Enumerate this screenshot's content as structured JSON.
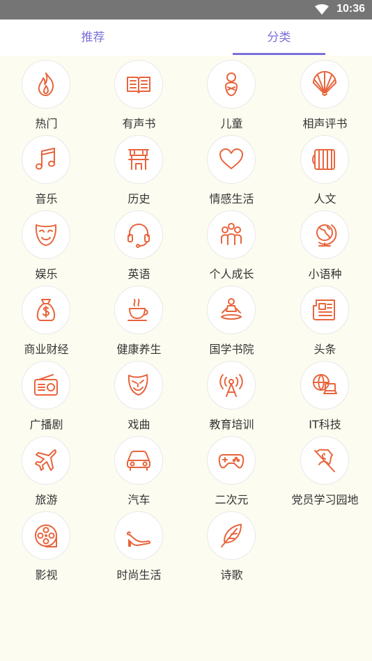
{
  "status": {
    "time": "10:36"
  },
  "tabs": [
    {
      "label": "推荐",
      "active": false
    },
    {
      "label": "分类",
      "active": true
    }
  ],
  "accent_color": "#7b70d6",
  "icon_color": "#e8643c",
  "categories": [
    {
      "label": "热门",
      "icon": "fire-icon"
    },
    {
      "label": "有声书",
      "icon": "open-book-icon"
    },
    {
      "label": "儿童",
      "icon": "baby-icon"
    },
    {
      "label": "相声评书",
      "icon": "folding-fan-icon"
    },
    {
      "label": "音乐",
      "icon": "music-note-icon"
    },
    {
      "label": "历史",
      "icon": "ancient-gate-icon"
    },
    {
      "label": "情感生活",
      "icon": "heart-icon"
    },
    {
      "label": "人文",
      "icon": "scroll-icon"
    },
    {
      "label": "娱乐",
      "icon": "mask-icon"
    },
    {
      "label": "英语",
      "icon": "headset-icon"
    },
    {
      "label": "个人成长",
      "icon": "people-icon"
    },
    {
      "label": "小语种",
      "icon": "globe-icon"
    },
    {
      "label": "商业财经",
      "icon": "money-bag-icon"
    },
    {
      "label": "健康养生",
      "icon": "tea-cup-icon"
    },
    {
      "label": "国学书院",
      "icon": "meditation-icon"
    },
    {
      "label": "头条",
      "icon": "newspaper-icon"
    },
    {
      "label": "广播剧",
      "icon": "radio-icon"
    },
    {
      "label": "戏曲",
      "icon": "opera-mask-icon"
    },
    {
      "label": "教育培训",
      "icon": "broadcast-tower-icon"
    },
    {
      "label": "IT科技",
      "icon": "computer-globe-icon"
    },
    {
      "label": "旅游",
      "icon": "airplane-icon"
    },
    {
      "label": "汽车",
      "icon": "car-icon"
    },
    {
      "label": "二次元",
      "icon": "gamepad-icon"
    },
    {
      "label": "党员学习园地",
      "icon": "party-flag-icon"
    },
    {
      "label": "影视",
      "icon": "film-reel-icon"
    },
    {
      "label": "时尚生活",
      "icon": "high-heel-icon"
    },
    {
      "label": "诗歌",
      "icon": "feather-icon"
    }
  ]
}
